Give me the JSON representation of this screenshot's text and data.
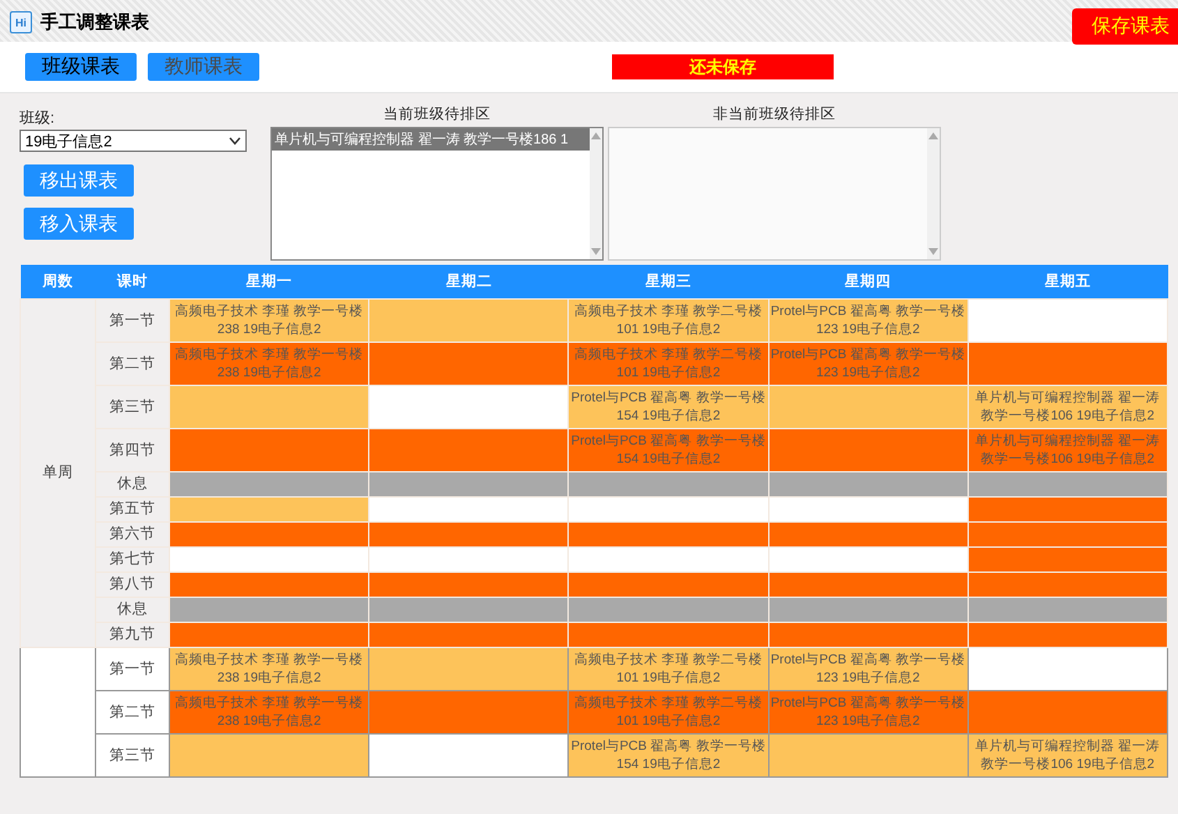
{
  "window": {
    "icon_text": "Hi",
    "title": "手工调整课表"
  },
  "save_button": "保存课表",
  "tabs": [
    {
      "label": "班级课表",
      "selected": true
    },
    {
      "label": "教师课表",
      "selected": false
    }
  ],
  "status": "还未保存",
  "class_field": {
    "label": "班级:",
    "value": "19电子信息2"
  },
  "actions": [
    "移出课表",
    "移入课表"
  ],
  "pending_lists": [
    {
      "title": "当前班级待排区",
      "items": [
        {
          "text": "单片机与可编程控制器 翟一涛 教学一号楼186 1",
          "selected": true
        }
      ]
    },
    {
      "title": "非当前班级待排区"
    }
  ],
  "table": {
    "columns": [
      "周数",
      "课时",
      "星期一",
      "星期二",
      "星期三",
      "星期四",
      "星期五"
    ],
    "weeks": [
      {
        "label": "单周",
        "rows": [
          {
            "period": "第一节",
            "cells": [
              {
                "kind": "light",
                "text": "高频电子技术 李瑾 教学一号楼 238 19电子信息2"
              },
              {
                "kind": "light"
              },
              {
                "kind": "light",
                "text": "高频电子技术 李瑾 教学二号楼 101 19电子信息2"
              },
              {
                "kind": "light",
                "text": "Protel与PCB 翟高粤 教学一号楼 123 19电子信息2"
              },
              {
                "kind": "empty"
              }
            ]
          },
          {
            "period": "第二节",
            "cells": [
              {
                "kind": "dark",
                "text": "高频电子技术 李瑾 教学一号楼 238 19电子信息2"
              },
              {
                "kind": "dark"
              },
              {
                "kind": "dark",
                "text": "高频电子技术 李瑾 教学二号楼 101 19电子信息2"
              },
              {
                "kind": "dark",
                "text": "Protel与PCB 翟高粤 教学一号楼 123 19电子信息2"
              },
              {
                "kind": "dark"
              }
            ]
          },
          {
            "period": "第三节",
            "cells": [
              {
                "kind": "light"
              },
              {
                "kind": "empty"
              },
              {
                "kind": "light",
                "text": "Protel与PCB 翟高粤 教学一号楼 154 19电子信息2"
              },
              {
                "kind": "light"
              },
              {
                "kind": "light",
                "text": "单片机与可编程控制器 翟一涛教学一号楼106 19电子信息2"
              }
            ]
          },
          {
            "period": "第四节",
            "cells": [
              {
                "kind": "dark"
              },
              {
                "kind": "dark"
              },
              {
                "kind": "dark",
                "text": "Protel与PCB 翟高粤 教学一号楼 154 19电子信息2"
              },
              {
                "kind": "dark"
              },
              {
                "kind": "dark",
                "text": "单片机与可编程控制器 翟一涛教学一号楼106 19电子信息2"
              }
            ]
          },
          {
            "period": "休息",
            "cells": [
              {
                "kind": "break"
              },
              {
                "kind": "break"
              },
              {
                "kind": "break"
              },
              {
                "kind": "break"
              },
              {
                "kind": "break"
              }
            ]
          },
          {
            "period": "第五节",
            "cells": [
              {
                "kind": "light"
              },
              {
                "kind": "empty"
              },
              {
                "kind": "empty"
              },
              {
                "kind": "empty"
              },
              {
                "kind": "dark"
              }
            ]
          },
          {
            "period": "第六节",
            "cells": [
              {
                "kind": "dark"
              },
              {
                "kind": "dark"
              },
              {
                "kind": "dark"
              },
              {
                "kind": "dark"
              },
              {
                "kind": "dark"
              }
            ]
          },
          {
            "period": "第七节",
            "cells": [
              {
                "kind": "empty"
              },
              {
                "kind": "empty"
              },
              {
                "kind": "empty"
              },
              {
                "kind": "empty"
              },
              {
                "kind": "dark"
              }
            ]
          },
          {
            "period": "第八节",
            "cells": [
              {
                "kind": "dark"
              },
              {
                "kind": "dark"
              },
              {
                "kind": "dark"
              },
              {
                "kind": "dark"
              },
              {
                "kind": "dark"
              }
            ]
          },
          {
            "period": "休息",
            "cells": [
              {
                "kind": "break"
              },
              {
                "kind": "break"
              },
              {
                "kind": "break"
              },
              {
                "kind": "break"
              },
              {
                "kind": "break"
              }
            ]
          },
          {
            "period": "第九节",
            "cells": [
              {
                "kind": "dark"
              },
              {
                "kind": "dark"
              },
              {
                "kind": "dark"
              },
              {
                "kind": "dark"
              },
              {
                "kind": "dark"
              }
            ]
          }
        ]
      },
      {
        "rows": [
          {
            "period": "第一节",
            "cells": [
              {
                "kind": "light",
                "text": "高频电子技术 李瑾 教学一号楼 238 19电子信息2"
              },
              {
                "kind": "light"
              },
              {
                "kind": "light",
                "text": "高频电子技术 李瑾 教学二号楼 101 19电子信息2"
              },
              {
                "kind": "light",
                "text": "Protel与PCB 翟高粤 教学一号楼 123 19电子信息2"
              },
              {
                "kind": "empty"
              }
            ]
          },
          {
            "period": "第二节",
            "cells": [
              {
                "kind": "dark",
                "text": "高频电子技术 李瑾 教学一号楼 238 19电子信息2"
              },
              {
                "kind": "dark"
              },
              {
                "kind": "dark",
                "text": "高频电子技术 李瑾 教学二号楼 101 19电子信息2"
              },
              {
                "kind": "dark",
                "text": "Protel与PCB 翟高粤 教学一号楼 123 19电子信息2"
              },
              {
                "kind": "dark"
              }
            ]
          },
          {
            "period": "第三节",
            "cells": [
              {
                "kind": "light"
              },
              {
                "kind": "empty"
              },
              {
                "kind": "light",
                "text": "Protel与PCB 翟高粤 教学一号楼 154 19电子信息2"
              },
              {
                "kind": "light"
              },
              {
                "kind": "light",
                "text": "单片机与可编程控制器 翟一涛教学一号楼106 19电子信息2"
              }
            ]
          }
        ]
      }
    ]
  }
}
